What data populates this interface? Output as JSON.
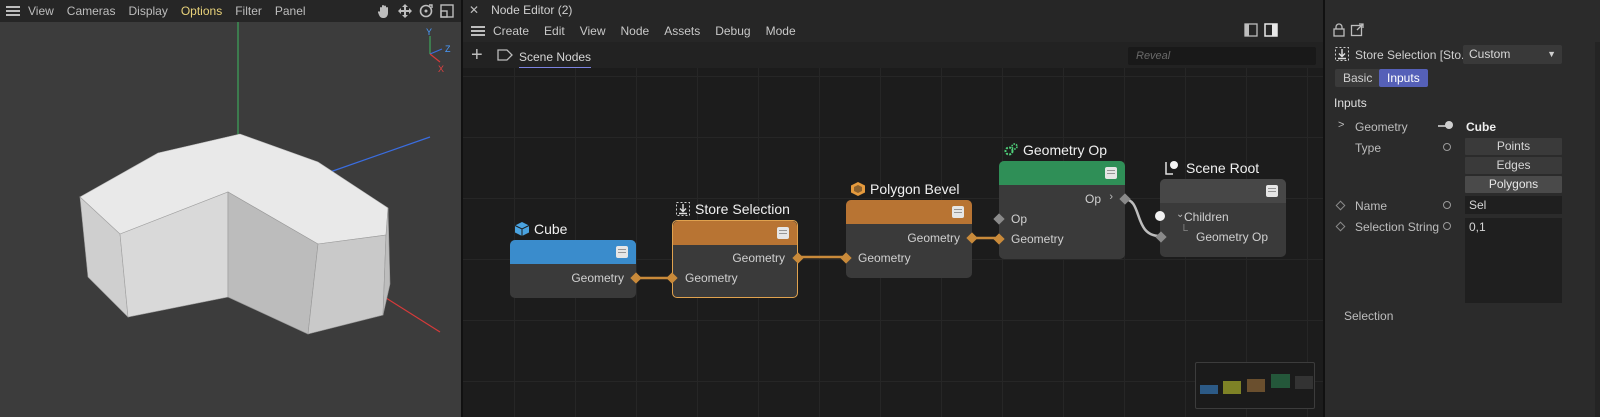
{
  "viewport": {
    "menu": [
      "View",
      "Cameras",
      "Display",
      "Options",
      "Filter",
      "Panel"
    ],
    "active_menu": "Options",
    "tool_icons": [
      "hand-icon",
      "move-icon",
      "rotate-icon",
      "maximize-icon"
    ],
    "gizmo_labels": {
      "y": "Y",
      "z": "Z",
      "x": "X"
    }
  },
  "node_editor": {
    "title": "Node Editor (2)",
    "menu": [
      "Create",
      "Edit",
      "View",
      "Node",
      "Assets",
      "Debug",
      "Mode"
    ],
    "tab": "Scene Nodes",
    "reveal_placeholder": "Reveal",
    "nodes": {
      "cube": {
        "title": "Cube",
        "out_port": "Geometry",
        "color": "#3a8ccc"
      },
      "store_selection": {
        "title": "Store Selection",
        "in_port": "Geometry",
        "out_port": "Geometry",
        "color": "#b87433"
      },
      "polygon_bevel": {
        "title": "Polygon Bevel",
        "in_port": "Geometry",
        "out_port": "Geometry",
        "color": "#b87433"
      },
      "geometry_op": {
        "title": "Geometry Op",
        "in_port_op": "Op",
        "in_port_geo": "Geometry",
        "out_port": "Op",
        "color": "#2f8f57"
      },
      "scene_root": {
        "title": "Scene Root",
        "children": "Children",
        "child_item": "Geometry Op",
        "color": "#474747"
      }
    }
  },
  "attributes": {
    "header_title": "Store Selection [Sto...",
    "mode": "Custom",
    "tabs": [
      "Basic",
      "Inputs"
    ],
    "active_tab": "Inputs",
    "section": "Inputs",
    "rows": {
      "geometry_label": "Geometry",
      "geometry_value": "Cube",
      "type_label": "Type",
      "type_options": [
        "Points",
        "Edges",
        "Polygons"
      ],
      "type_selected": "Polygons",
      "name_label": "Name",
      "name_value": "Sel",
      "selection_string_label": "Selection String",
      "selection_string_value": "0,1",
      "selection_label": "Selection"
    }
  }
}
